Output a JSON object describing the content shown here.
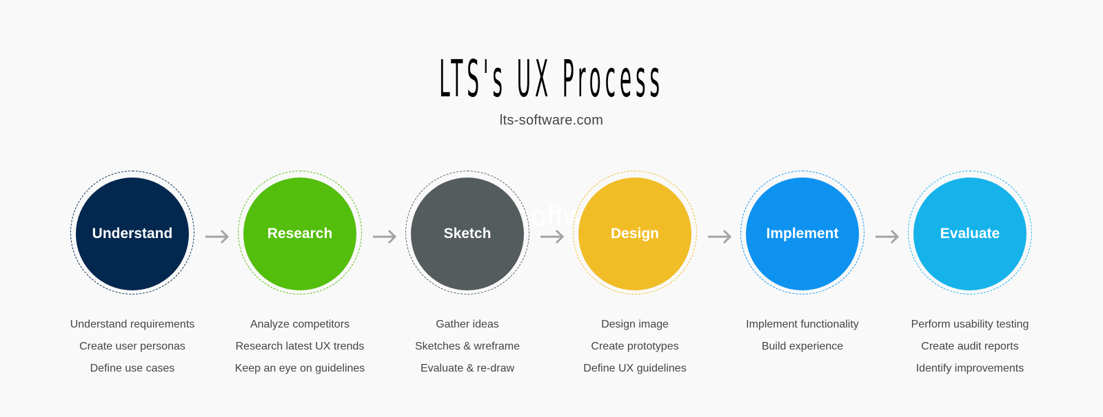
{
  "header": {
    "title": "LTS's UX Process",
    "subtitle": "lts-software.com",
    "watermark": "lts-software"
  },
  "steps": [
    {
      "label": "Understand",
      "color": "#03284f",
      "ring_color": "#03284f",
      "items": [
        "Understand requirements",
        "Create user personas",
        "Define use cases"
      ]
    },
    {
      "label": "Research",
      "color": "#53be0b",
      "ring_color": "#53be0b",
      "items": [
        "Analyze competitors",
        "Research latest UX trends",
        "Keep an eye on guidelines"
      ]
    },
    {
      "label": "Sketch",
      "color": "#555c5e",
      "ring_color": "#555c5e",
      "items": [
        "Gather ideas",
        "Sketches & wreframe",
        "Evaluate & re-draw"
      ]
    },
    {
      "label": "Design",
      "color": "#f1bd26",
      "ring_color": "#f1bd26",
      "items": [
        "Design image",
        "Create prototypes",
        "Define UX guidelines"
      ]
    },
    {
      "label": "Implement",
      "color": "#0e92f0",
      "ring_color": "#0e92f0",
      "items": [
        "Implement functionality",
        "Build experience"
      ]
    },
    {
      "label": "Evaluate",
      "color": "#16b3ea",
      "ring_color": "#16b3ea",
      "items": [
        "Perform usability testing",
        "Create audit reports",
        "Identify improvements"
      ]
    }
  ],
  "arrow_color": "#a3a3a3"
}
